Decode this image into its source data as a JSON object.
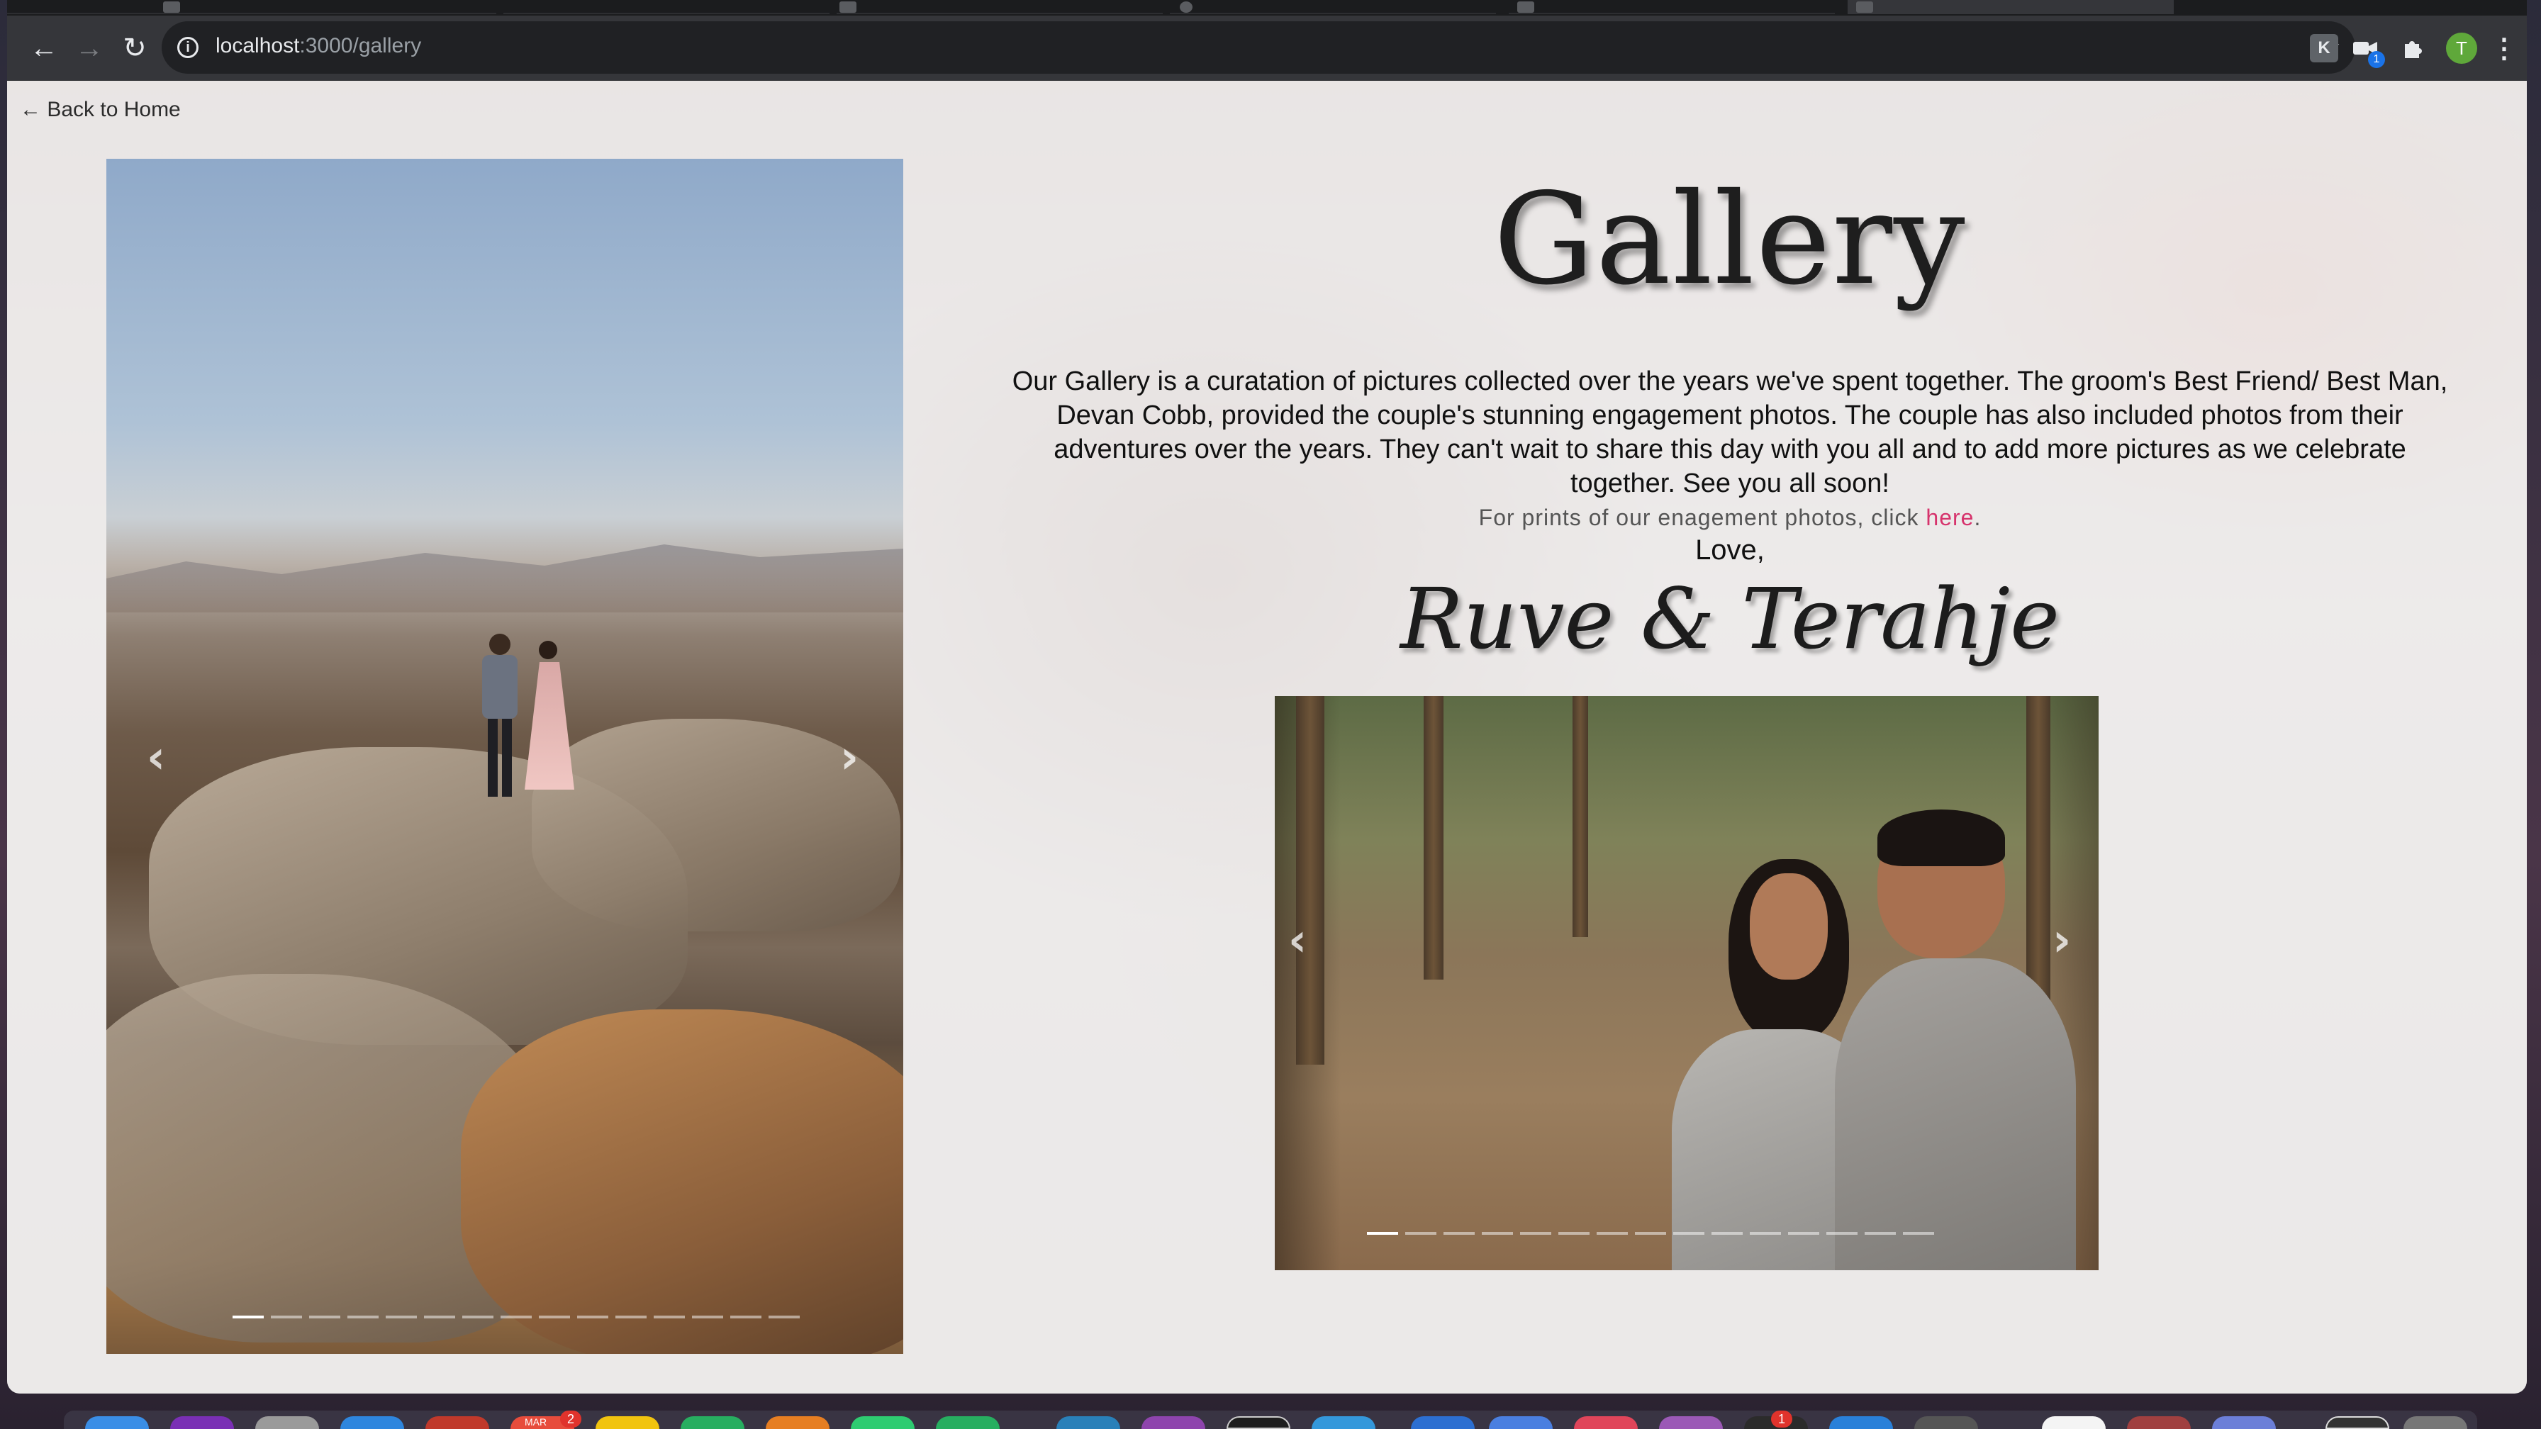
{
  "browser": {
    "url_host": "localhost",
    "url_path": ":3000/gallery",
    "profile_initial": "T",
    "extension_badge": "1"
  },
  "page": {
    "back_link": "← Back to Home",
    "title": "Gallery",
    "paragraph": "Our Gallery is a curatation of pictures collected over the years we've spent together. The groom's Best Friend/ Best Man, Devan Cobb, provided the couple's stunning engagement photos. The couple has also included photos from their adventures over the years. They can't wait to share this day with you all and to add more pictures as we celebrate together. See you all soon!",
    "prints_prefix": "For prints of our enagement photos, click ",
    "prints_link": "here",
    "prints_suffix": ".",
    "love": "Love,",
    "signature": "Ruve & Terahje",
    "link_color": "#d6336c"
  },
  "carousel_left": {
    "slide_count": 15,
    "active_index": 0,
    "prev_icon": "chevron-left-icon",
    "next_icon": "chevron-right-icon"
  },
  "carousel_right": {
    "slide_count": 15,
    "active_index": 0,
    "prev_icon": "chevron-left-icon",
    "next_icon": "chevron-right-icon"
  },
  "dock": {
    "calendar_label": "MAR",
    "calendar_badge": "2",
    "app_badge": "1"
  }
}
